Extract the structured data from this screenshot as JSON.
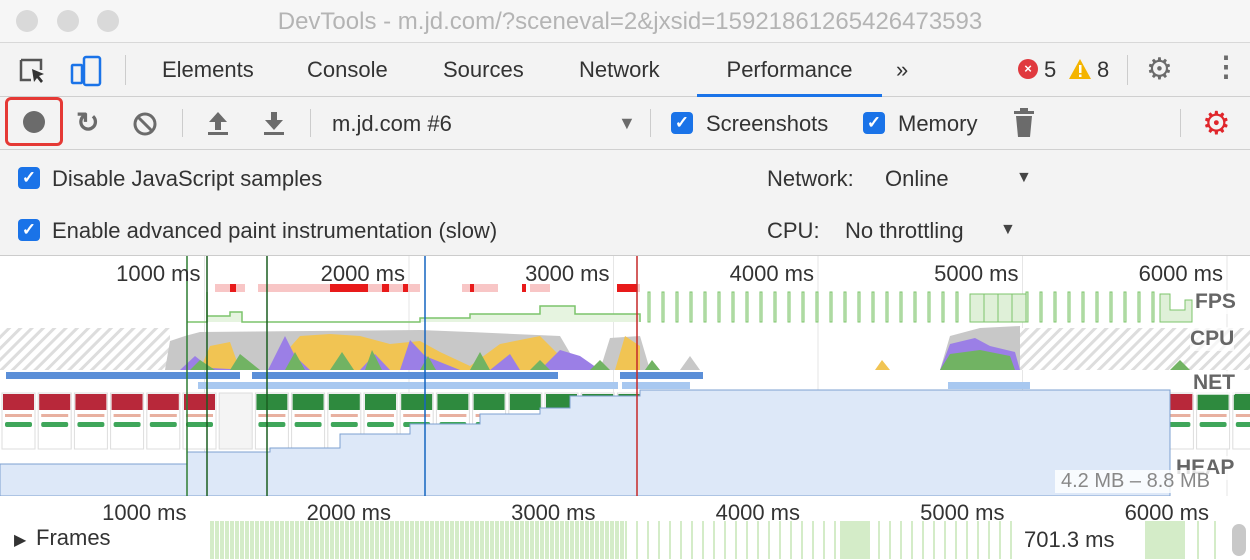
{
  "window": {
    "title": "DevTools - m.jd.com/?sceneval=2&jxsid=15921861265426473593"
  },
  "tabs": [
    {
      "label": "Elements"
    },
    {
      "label": "Console"
    },
    {
      "label": "Sources"
    },
    {
      "label": "Network"
    },
    {
      "label": "Performance",
      "active": true
    }
  ],
  "more_tabs_icon": "»",
  "status": {
    "errors": "5",
    "warnings": "8"
  },
  "toolbar": {
    "profile_select": "m.jd.com #6",
    "screenshots_label": "Screenshots",
    "screenshots_checked": true,
    "memory_label": "Memory",
    "memory_checked": true
  },
  "settings": {
    "disable_js_label": "Disable JavaScript samples",
    "disable_js_checked": true,
    "advanced_paint_label": "Enable advanced paint instrumentation (slow)",
    "advanced_paint_checked": true,
    "network_label": "Network:",
    "network_value": "Online",
    "cpu_label": "CPU:",
    "cpu_value": "No throttling"
  },
  "overview": {
    "ticks": [
      "1000 ms",
      "2000 ms",
      "3000 ms",
      "4000 ms",
      "5000 ms",
      "6000 ms"
    ],
    "tracks": {
      "fps": "FPS",
      "cpu": "CPU",
      "net": "NET",
      "heap": "HEAP"
    },
    "heap_range": "4.2 MB – 8.8 MB"
  },
  "lower_ruler": {
    "ticks": [
      "1000 ms",
      "2000 ms",
      "3000 ms",
      "4000 ms",
      "5000 ms",
      "6000 ms"
    ]
  },
  "frames": {
    "label": "Frames",
    "duration": "701.3 ms"
  },
  "colors": {
    "accent": "#1a73e8",
    "record_highlight": "#e53935",
    "scripting": "#f1c453",
    "rendering": "#9b7fe6",
    "painting": "#71b363",
    "other": "#c8c8c8",
    "net_dark": "#5b8fd8",
    "net_light": "#a8c8f0",
    "heap_fill": "#dde8f8",
    "error": "#e0393e",
    "warning": "#f4b400"
  }
}
